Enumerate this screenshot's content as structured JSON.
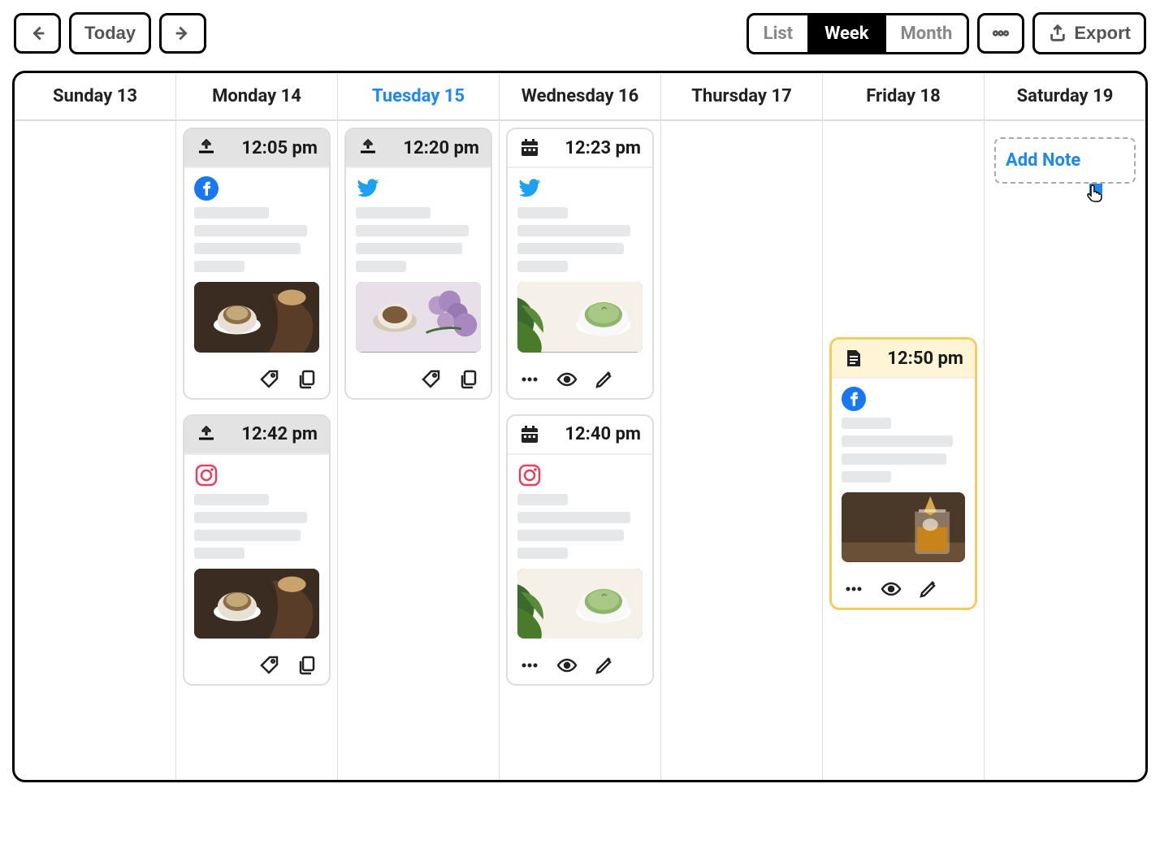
{
  "toolbar": {
    "today": "Today",
    "views": {
      "list": "List",
      "week": "Week",
      "month": "Month",
      "active": "week"
    },
    "export": "Export"
  },
  "days": [
    {
      "label": "Sunday 13"
    },
    {
      "label": "Monday 14"
    },
    {
      "label": "Tuesday 15",
      "active": true
    },
    {
      "label": "Wednesday 16"
    },
    {
      "label": "Thursday 17"
    },
    {
      "label": "Friday 18"
    },
    {
      "label": "Saturday 19"
    }
  ],
  "posts": {
    "mon1": {
      "time": "12:05 pm",
      "status": "upload",
      "network": "facebook",
      "thumb": "coffee",
      "actions": [
        "tag",
        "copy"
      ]
    },
    "mon2": {
      "time": "12:42 pm",
      "status": "upload",
      "network": "instagram",
      "thumb": "coffee",
      "actions": [
        "tag",
        "copy"
      ]
    },
    "tue1": {
      "time": "12:20 pm",
      "status": "upload",
      "network": "twitter",
      "thumb": "lilac",
      "actions": [
        "tag",
        "copy"
      ]
    },
    "wed1": {
      "time": "12:23 pm",
      "status": "scheduled",
      "network": "twitter",
      "thumb": "matcha",
      "actions": [
        "more",
        "view",
        "edit"
      ]
    },
    "wed2": {
      "time": "12:40 pm",
      "status": "scheduled",
      "network": "instagram",
      "thumb": "matcha",
      "actions": [
        "more",
        "view",
        "edit"
      ]
    },
    "fri1": {
      "time": "12:50 pm",
      "status": "draft",
      "network": "facebook",
      "thumb": "whiskey",
      "actions": [
        "more",
        "view",
        "edit"
      ],
      "highlight": true
    }
  },
  "add_note_label": "Add Note",
  "colors": {
    "accent": "#1e88f0",
    "facebook": "#1877f2",
    "twitter": "#1da1f2",
    "instagram": "#e4405f",
    "highlight_border": "#f3ce5e"
  }
}
